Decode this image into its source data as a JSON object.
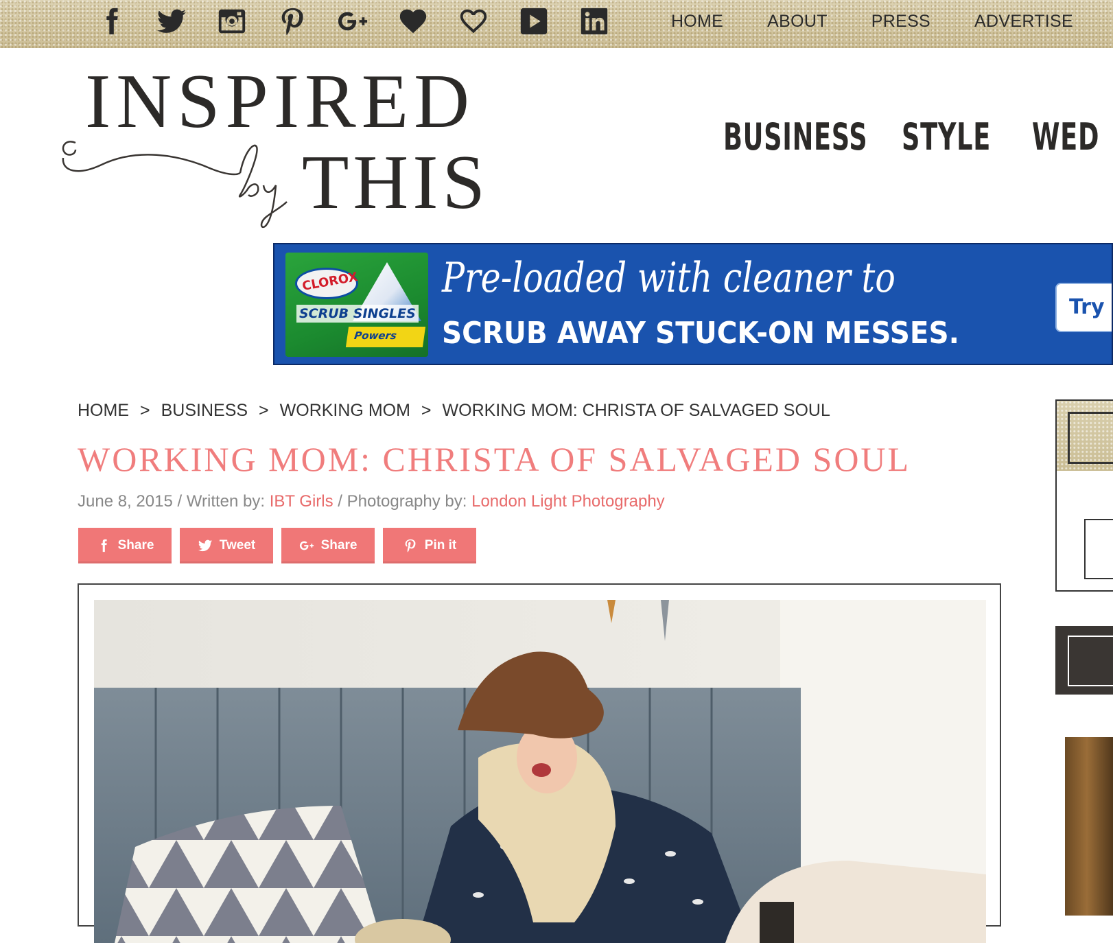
{
  "topbar": {
    "social_icons": [
      "facebook-icon",
      "twitter-icon",
      "instagram-icon",
      "pinterest-icon",
      "google-plus-icon",
      "heart-icon",
      "heart-outline-icon",
      "youtube-icon",
      "linkedin-icon"
    ],
    "nav": [
      "HOME",
      "ABOUT",
      "PRESS",
      "ADVERTISE"
    ]
  },
  "logo": {
    "line1": "INSPIRED",
    "script": "by",
    "line2": "THIS"
  },
  "main_nav": [
    "BUSINESS",
    "STYLE",
    "WED"
  ],
  "ad": {
    "product_brand": "CLOROX",
    "product_name": "SCRUB SINGLES",
    "product_tag": "Powers",
    "headline_1": "Pre-loaded with cleaner to",
    "headline_2": "SCRUB AWAY STUCK-ON MESSES.",
    "cta": "Try It"
  },
  "breadcrumb": {
    "items": [
      "HOME",
      "BUSINESS",
      "WORKING MOM",
      "WORKING MOM: CHRISTA OF SALVAGED SOUL"
    ],
    "separator": ">"
  },
  "post": {
    "title": "WORKING MOM: CHRISTA OF SALVAGED SOUL",
    "date": "June 8, 2015",
    "written_label": " / Written by: ",
    "author": "IBT Girls",
    "photo_label": " / Photography by: ",
    "photographer": "London Light Photography"
  },
  "share_buttons": [
    {
      "icon": "facebook-icon",
      "label": "Share"
    },
    {
      "icon": "twitter-icon",
      "label": "Tweet"
    },
    {
      "icon": "google-plus-icon",
      "label": "Share"
    },
    {
      "icon": "pinterest-icon",
      "label": "Pin it"
    }
  ],
  "colors": {
    "accent": "#f07777",
    "title": "#f07d7d",
    "link": "#e86b6b",
    "ad_blue": "#1a53ae",
    "text_dark": "#2c2a28"
  }
}
